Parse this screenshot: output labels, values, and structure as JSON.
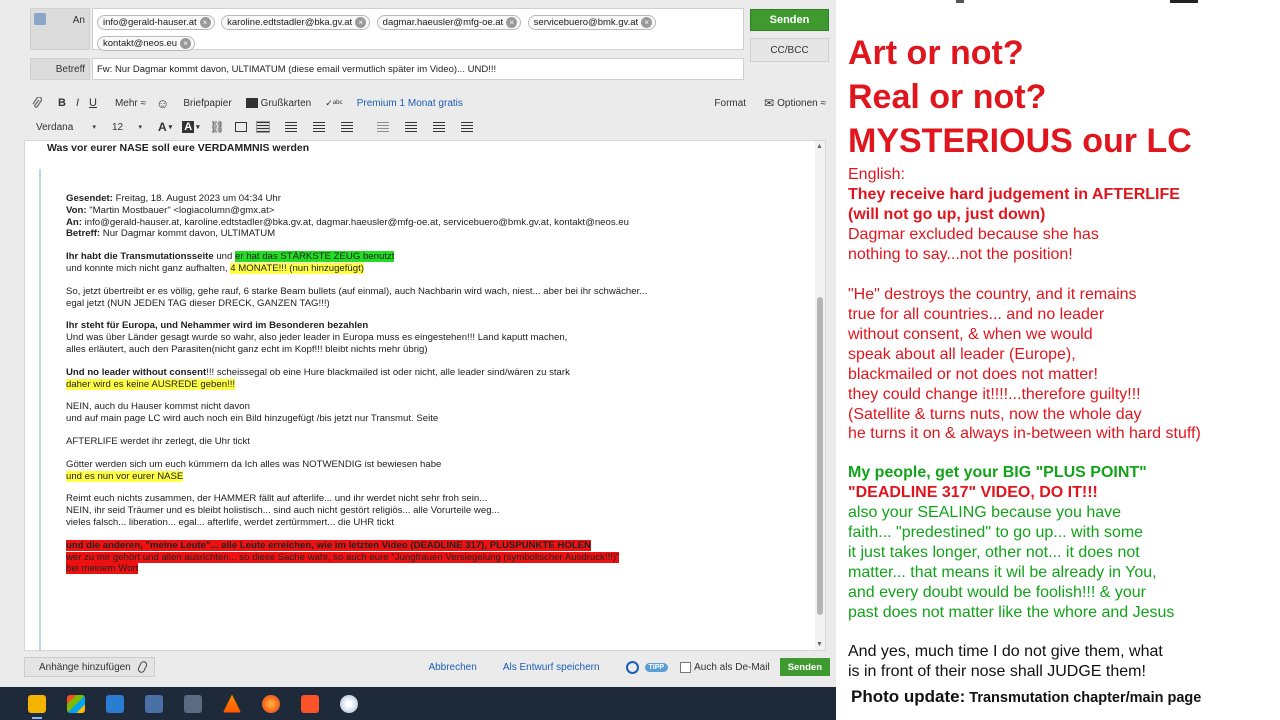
{
  "compose": {
    "to_label": "An",
    "recipients": [
      "info@gerald-hauser.at",
      "karoline.edtstadler@bka.gv.at",
      "dagmar.haeusler@mfg-oe.at",
      "servicebuero@bmk.gv.at",
      "kontakt@neos.eu"
    ],
    "subject_label": "Betreff",
    "subject": "Fw: Nur Dagmar kommt davon, ULTIMATUM (diese email vermutlich später im Video)... UND!!!",
    "send_label": "Senden",
    "ccbcc_label": "CC/BCC"
  },
  "toolbar1": {
    "bold": "B",
    "italic": "I",
    "underline": "U",
    "more": "Mehr ≈",
    "emoji": "☺",
    "letterhead": "Briefpapier",
    "cards": "Grußkarten",
    "premium": "Premium 1 Monat gratis",
    "format": "Format",
    "options": "Optionen ≈"
  },
  "toolbar2": {
    "font": "Verdana",
    "size": "12"
  },
  "editor": {
    "top_line": "Was vor eurer NASE soll eure VERDAMMNIS werden",
    "meta": {
      "sent_label": "Gesendet:",
      "sent": "Freitag, 18. August 2023 um 04:34 Uhr",
      "from_label": "Von:",
      "from": "\"Martin Mostbauer\" <logiacolumn@gmx.at>",
      "to_label": "An:",
      "to": "info@gerald-hauser.at, karoline.edtstadler@bka.gv.at, dagmar.haeusler@mfg-oe.at, servicebuero@bmk.gv.at, kontakt@neos.eu",
      "subject_label": "Betreff:",
      "subject": "Nur Dagmar kommt davon, ULTIMATUM"
    },
    "p1a": "Ihr habt die Transmutationsseite",
    "p1b": " und ",
    "p1c": "er hat das STÄRKSTE ZEUG benutzt",
    "p1d": "und konnte mich nicht ganz aufhalten, ",
    "p1e": "4 MONATE!!! (nun hinzugefügt)",
    "p2a": "So, jetzt übertreibt er es völlig, gehe rauf, 6 starke Beam bullets (auf einmal), auch Nachbarin wird wach, niest... aber bei ihr schwächer...",
    "p2b": "egal jetzt (NUN JEDEN TAG dieser DRECK, GANZEN TAG!!!)",
    "p3a": "Ihr steht für Europa, und Nehammer wird im Besonderen bezahlen",
    "p3b": "Und was über Länder gesagt wurde so wahr, also jeder leader in Europa muss es eingestehen!!! Land kaputt machen,",
    "p3c": "alles erläutert, auch den Parasiten(nicht ganz echt im Kopf!!! bleibt nichts mehr übrig)",
    "p4a": "Und no leader without consent",
    "p4b": "!!! scheissegal ob eine Hure blackmailed ist oder nicht, alle leader sind/wären zu stark",
    "p4c": "daher wird es keine AUSREDE geben!!!",
    "p5a": "NEIN, auch du Hauser kommst nicht davon",
    "p5b": "und auf main page LC wird auch noch ein Bild hinzugefügt /bis jetzt nur Transmut. Seite",
    "p6": "AFTERLIFE werdet ihr zerlegt, die Uhr tickt",
    "p7a": "Götter werden sich um euch kümmern da Ich alles was NOTWENDIG ist bewiesen habe",
    "p7b": "und es nun vor eurer NASE",
    "p8a": "Reimt euch nichts zusammen, der HAMMER fällt auf afterlife... und ihr werdet nicht sehr froh sein...",
    "p8b": "NEIN, ihr seid Träumer und es bleibt holistisch... sind auch nicht gestört religiös... alle Vorurteile weg...",
    "p8c": "vieles falsch... liberation... egal... afterlife, werdet zertürmmert... die UHR tickt",
    "p9a": "und die anderen, \"meine Leute\"... alle Leute erreichen, wie im letzten Video (DEADLINE 317), PLUSPUNKTE HOLEN",
    "p9b": "wer zu mir gehört und allen ausrichten... so diese Sache wahr, so auch eure \"Jungfrauen Versiegelung (symbolischer Ausdruck!!!)\"",
    "p9c": "bei meinem Wort"
  },
  "bottom": {
    "attach": "Anhänge hinzufügen",
    "cancel": "Abbrechen",
    "draft": "Als Entwurf speichern",
    "tipp": "TIPP",
    "demail": "Auch als De-Mail",
    "send": "Senden"
  },
  "annotation": {
    "h1": "Art or not?",
    "h2": "Real or not?",
    "h3": "MYSTERIOUS our LC",
    "l1": "English:",
    "l2": "They receive hard judgement in AFTERLIFE",
    "l3": "(will not go up, just down)",
    "l4": "Dagmar excluded because she has",
    "l5": "nothing to say...not the position!",
    "l6": "\"He\" destroys the country, and it remains",
    "l7": "true for all countries... and no leader",
    "l8": "without consent, & when we would",
    "l9": "speak about all leader (Europe),",
    "l10": "blackmailed or not does not matter!",
    "l11": "they could change it!!!!...therefore guilty!!!",
    "l12": "(Satellite & turns nuts, now the whole day",
    "l13": "he turns it on & always in-between with hard stuff)",
    "l14": "My people, get your BIG \"PLUS POINT\"",
    "l15": "\"DEADLINE 317\" VIDEO, DO IT!!!",
    "l16": "also your SEALING because you have",
    "l17": "faith... \"predestined\" to go up... with some",
    "l18": "it just takes longer, other not... it does not",
    "l19": "matter... that means it wil be already in You,",
    "l20": "and every doubt would be foolish!!! & your",
    "l21": "past does not matter like the whore and Jesus",
    "l22": "And yes, much time I do not give them, what",
    "l23": "is in front of their nose shall JUDGE them!",
    "photo_a": "Photo update:",
    "photo_b": " Transmutation chapter/main page"
  },
  "colors": {
    "accent_red": "#e0161e",
    "accent_green": "#13a31a",
    "send_green": "#3f9a30"
  },
  "taskbar_icons": [
    "file-explorer-icon",
    "microsoft-store-icon",
    "mail-icon",
    "app-icon",
    "calculator-icon",
    "vlc-icon",
    "firefox-icon",
    "brave-icon",
    "paint-icon"
  ]
}
